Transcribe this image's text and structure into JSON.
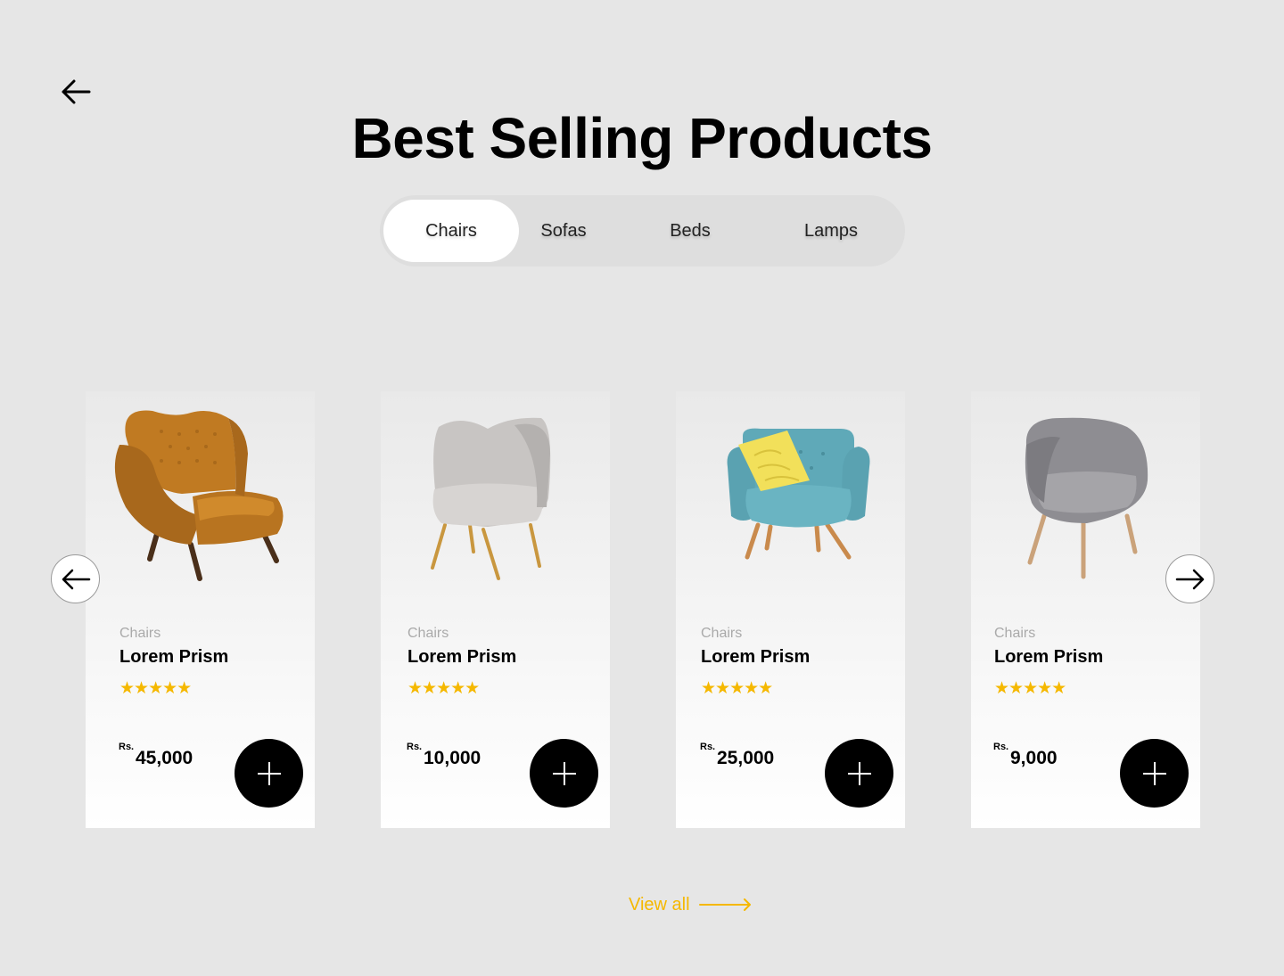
{
  "page": {
    "title": "Best Selling Products"
  },
  "tabs": [
    {
      "label": "Chairs",
      "active": true
    },
    {
      "label": "Sofas",
      "active": false
    },
    {
      "label": "Beds",
      "active": false
    },
    {
      "label": "Lamps",
      "active": false
    }
  ],
  "products": [
    {
      "category": "Chairs",
      "name": "Lorem Prism",
      "rating": 5,
      "stars": "★★★★★",
      "currency": "Rs.",
      "price": "45,000",
      "image": "orange-wingback-armchair"
    },
    {
      "category": "Chairs",
      "name": "Lorem Prism",
      "rating": 5,
      "stars": "★★★★★",
      "currency": "Rs.",
      "price": "10,000",
      "image": "grey-shell-chair"
    },
    {
      "category": "Chairs",
      "name": "Lorem Prism",
      "rating": 5,
      "stars": "★★★★★",
      "currency": "Rs.",
      "price": "25,000",
      "image": "teal-armchair-with-yellow-pillow"
    },
    {
      "category": "Chairs",
      "name": "Lorem Prism",
      "rating": 5,
      "stars": "★★★★★",
      "currency": "Rs.",
      "price": "9,000",
      "image": "grey-tub-chair"
    }
  ],
  "view_all": {
    "label": "View all"
  },
  "icons": {
    "back": "arrow-left-icon",
    "prev": "arrow-left-icon",
    "next": "arrow-right-icon",
    "add": "plus-icon",
    "view_all": "long-arrow-right-icon"
  },
  "colors": {
    "background": "#e6e6e6",
    "accent": "#f5b800",
    "button": "#000000",
    "tab_active": "#ffffff",
    "tab_track": "#dedede"
  }
}
